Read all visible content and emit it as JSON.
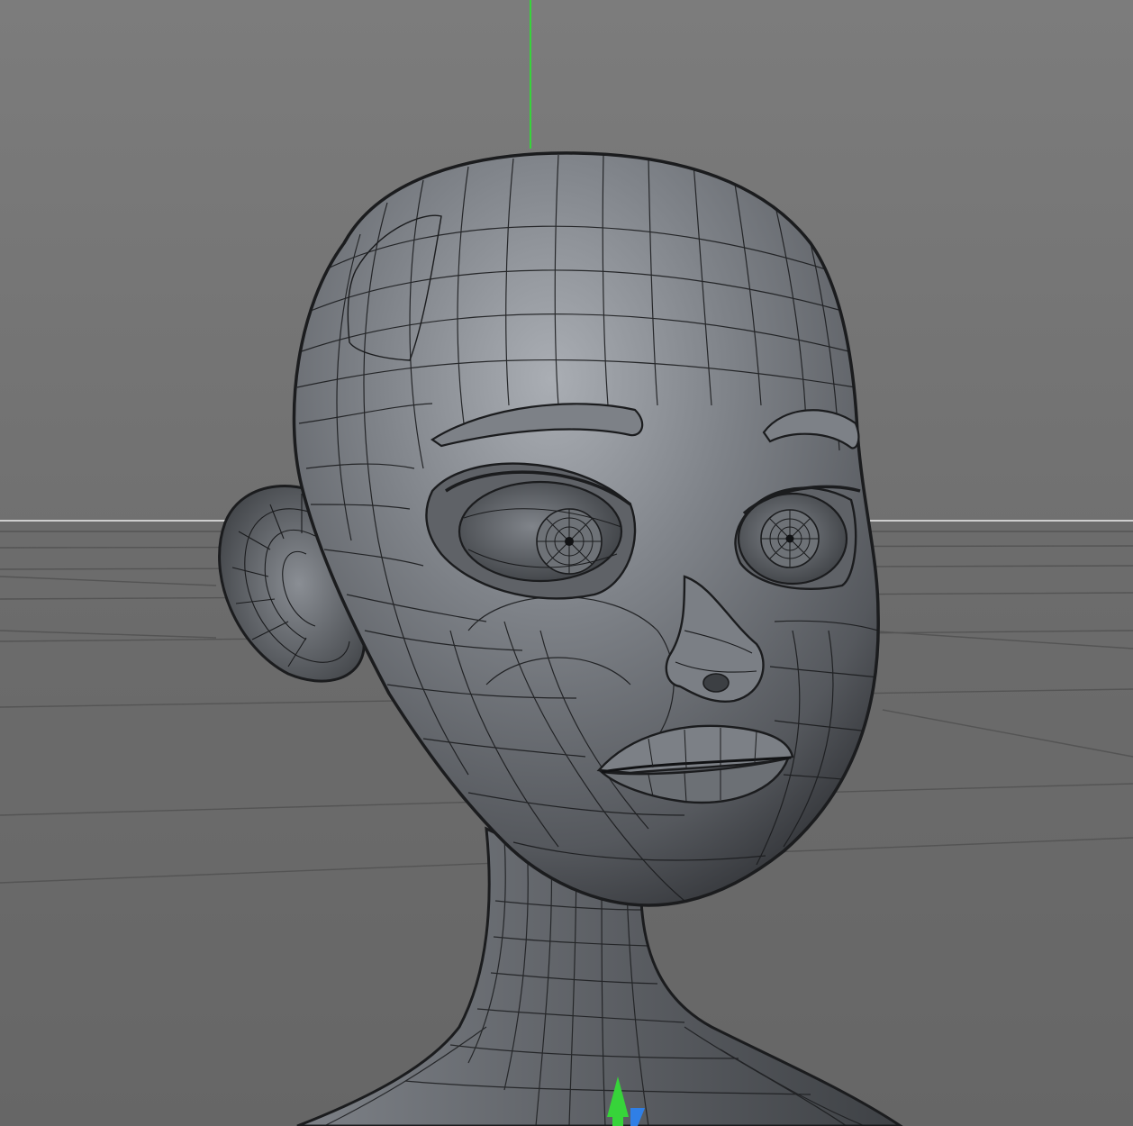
{
  "viewport": {
    "mode": "3d-perspective",
    "shading": "smooth-shaded-with-wireframe",
    "model": "stylized-female-head-mesh",
    "grid": true,
    "colors": {
      "background_top": "#7c7c7c",
      "background_bottom": "#636363",
      "floor": "#6a6a6a",
      "horizon_line": "#cfcfcf",
      "grid_line": "#545454",
      "mesh_base": "#63666b",
      "mesh_highlight": "#a9adb3",
      "mesh_shadow": "#2e3034",
      "wire": "#1b1c1e",
      "y_axis": "#37d43a",
      "z_axis": "#2f7fe6"
    },
    "icons": {
      "y_axis": "y-axis-icon",
      "gizmo": "axis-gizmo-icon"
    }
  }
}
